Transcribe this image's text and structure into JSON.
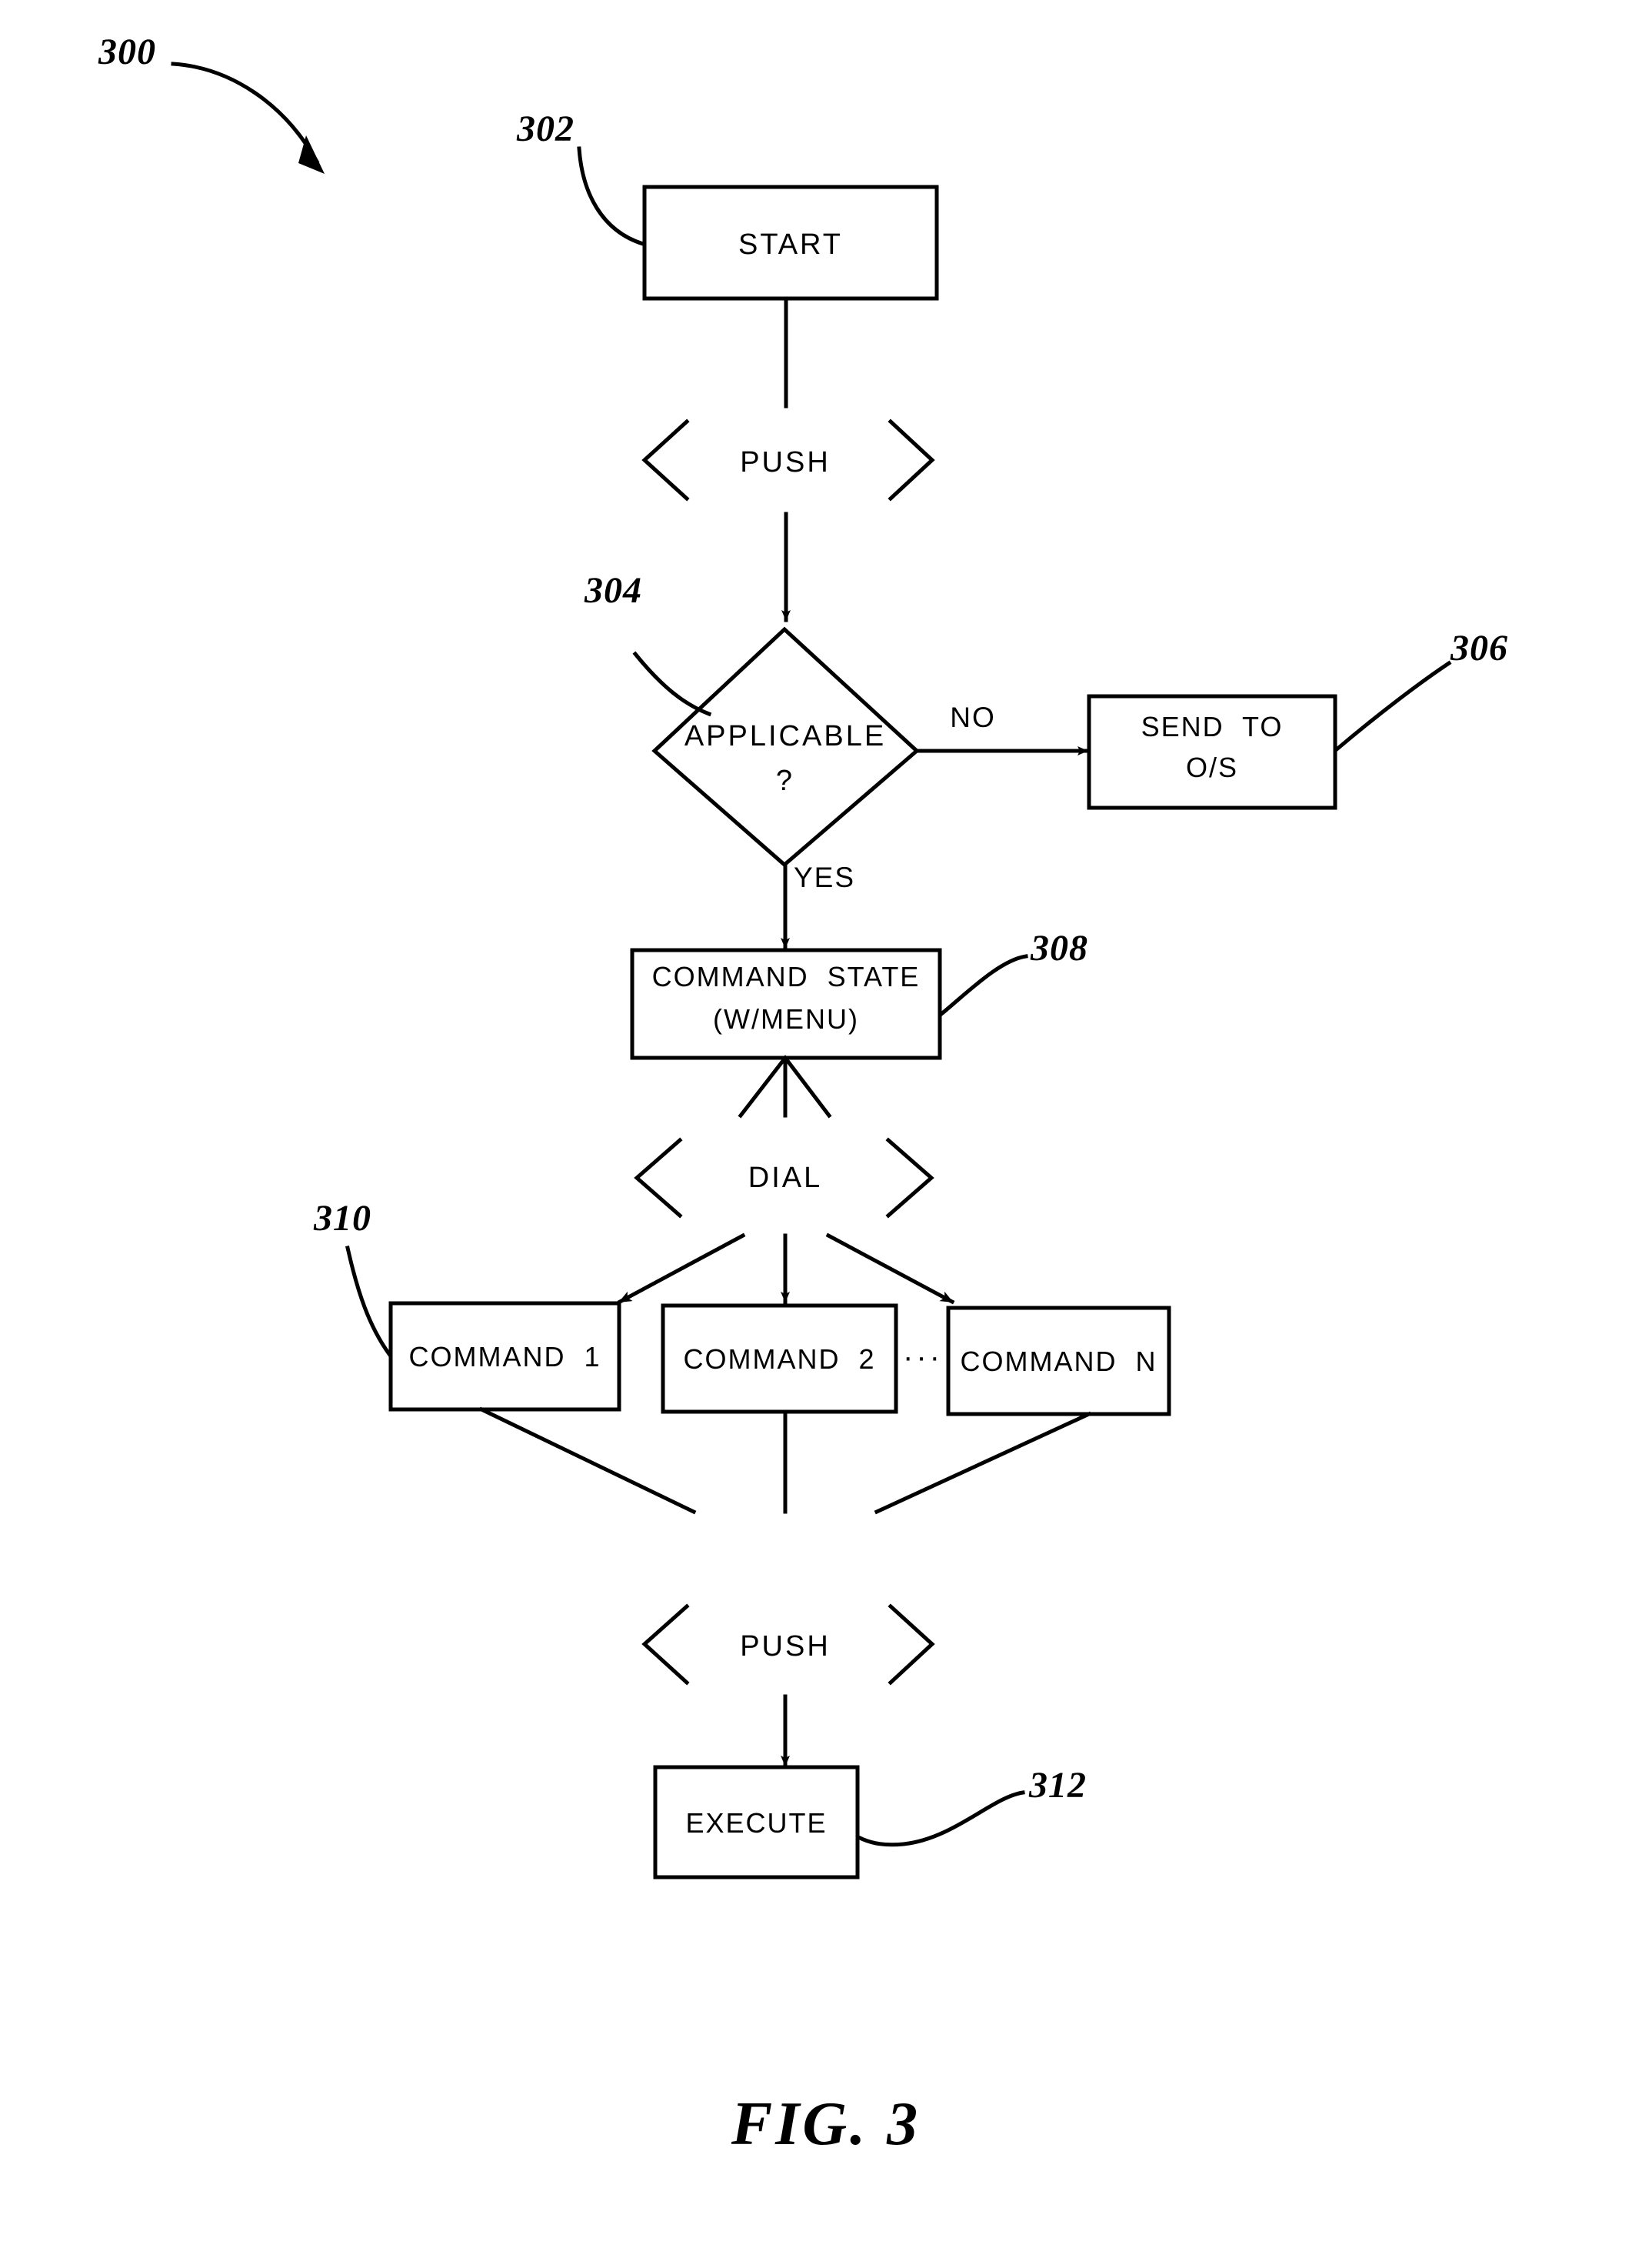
{
  "figure": {
    "caption": "FIG.  3",
    "diagram_ref": "300"
  },
  "nodes": [
    {
      "id": "start",
      "ref": "302",
      "label": "START",
      "shape": "rectangle"
    },
    {
      "id": "push_top",
      "ref": "",
      "label": "PUSH",
      "shape": "chevron-gate"
    },
    {
      "id": "applicable",
      "ref": "304",
      "label_line1": "APPLICABLE",
      "label_line2": "?",
      "shape": "diamond"
    },
    {
      "id": "send_to_os",
      "ref": "306",
      "label_line1": "SEND  TO",
      "label_line2": "O/S",
      "shape": "rectangle"
    },
    {
      "id": "command_state",
      "ref": "308",
      "label_line1": "COMMAND  STATE",
      "label_line2": "(W/MENU)",
      "shape": "rectangle"
    },
    {
      "id": "dial",
      "ref": "",
      "label": "DIAL",
      "shape": "chevron-gate"
    },
    {
      "id": "command_1",
      "ref": "310",
      "label": "COMMAND  1",
      "shape": "rectangle"
    },
    {
      "id": "command_2",
      "ref": "",
      "label": "COMMAND  2",
      "shape": "rectangle"
    },
    {
      "id": "command_n",
      "ref": "",
      "label": "COMMAND  N",
      "shape": "rectangle"
    },
    {
      "id": "push_bottom",
      "ref": "",
      "label": "PUSH",
      "shape": "chevron-gate"
    },
    {
      "id": "execute",
      "ref": "312",
      "label": "EXECUTE",
      "shape": "rectangle"
    }
  ],
  "edge_labels": {
    "no": "NO",
    "yes": "YES"
  },
  "command_series_ellipsis": "···",
  "reference_numerals": {
    "diagram": "300",
    "start": "302",
    "applicable": "304",
    "send_to_os": "306",
    "command_state": "308",
    "command_1": "310",
    "execute": "312"
  },
  "style": {
    "stroke": "#000000",
    "background": "#ffffff"
  }
}
